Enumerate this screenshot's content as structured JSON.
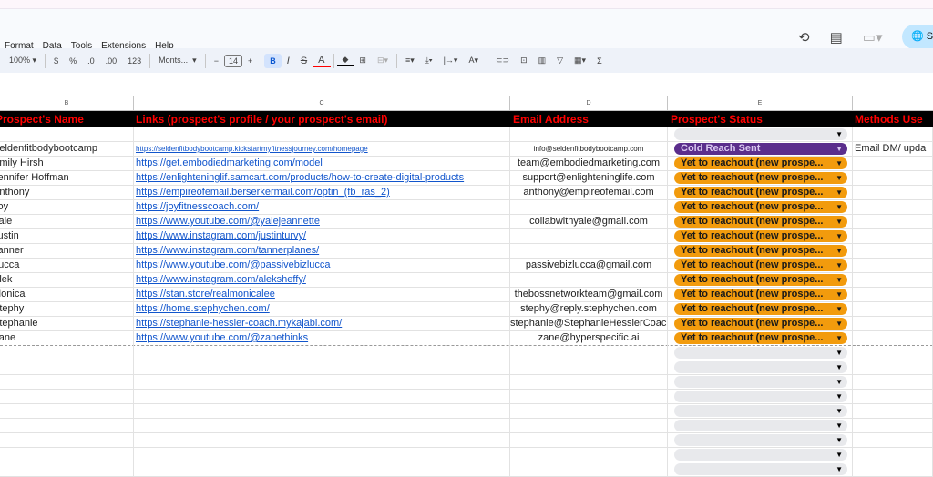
{
  "menu": [
    "Format",
    "Data",
    "Tools",
    "Extensions",
    "Help"
  ],
  "toolbar": {
    "zoom": "100%",
    "currency": "$",
    "percent": "%",
    "dec_decrease": ".0",
    "dec_increase": ".00",
    "number_format": "123",
    "font": "Monts...",
    "font_size": "14",
    "bold": "B",
    "italic": "I",
    "strike": "S",
    "text_color": "A",
    "sum": "Σ"
  },
  "share_label": "S",
  "columns": [
    "B",
    "C",
    "D",
    "E"
  ],
  "headers": {
    "name": "Prospect's Name",
    "links": "Links (prospect's profile / your prospect's email)",
    "email": "Email Address",
    "status": "Prospect's Status",
    "methods": "Methods Use"
  },
  "colors": {
    "orange": "#f29b0d",
    "purple": "#5b2e8c",
    "header_text": "#ff0000"
  },
  "rows": [
    {
      "name": "Seldenfitbodybootcamp",
      "link": "https://seldenfitbodybootcamp.kickstartmyfitnessjourney.com/homepage",
      "email": "info@seldenfitbodybootcamp.com",
      "status": "Cold Reach Sent",
      "status_type": "purple",
      "methods": "Email DM/ upda"
    },
    {
      "name": "Emily Hirsh",
      "link": "https://get.embodiedmarketing.com/model",
      "email": "team@embodiedmarketing.com",
      "status": "Yet to reachout (new prospe...",
      "status_type": "orange",
      "methods": ""
    },
    {
      "name": "Jennifer Hoffman",
      "link": "https://enlighteninglif.samcart.com/products/how-to-create-digital-products",
      "email": "support@enlighteninglife.com",
      "status": "Yet to reachout (new prospe...",
      "status_type": "orange",
      "methods": ""
    },
    {
      "name": "Anthony",
      "link": "https://empireofemail.berserkermail.com/optin_(fb_ras_2)",
      "email": "anthony@empireofemail.com",
      "status": "Yet to reachout (new prospe...",
      "status_type": "orange",
      "methods": ""
    },
    {
      "name": "Joy",
      "link": "https://joyfitnesscoach.com/",
      "email": "",
      "status": "Yet to reachout (new prospe...",
      "status_type": "orange",
      "methods": ""
    },
    {
      "name": "Yale",
      "link": "https://www.youtube.com/@yalejeannette",
      "email": "collabwithyale@gmail.com",
      "status": "Yet to reachout (new prospe...",
      "status_type": "orange",
      "methods": ""
    },
    {
      "name": "Justin",
      "link": "https://www.instagram.com/justinturvy/",
      "email": "",
      "status": "Yet to reachout (new prospe...",
      "status_type": "orange",
      "methods": ""
    },
    {
      "name": "Tanner",
      "link": "https://www.instagram.com/tannerplanes/",
      "email": "",
      "status": "Yet to reachout (new prospe...",
      "status_type": "orange",
      "methods": ""
    },
    {
      "name": "Lucca",
      "link": "https://www.youtube.com/@passivebizlucca",
      "email": "passivebizlucca@gmail.com",
      "status": "Yet to reachout (new prospe...",
      "status_type": "orange",
      "methods": ""
    },
    {
      "name": "Alek",
      "link": "https://www.instagram.com/aleksheffy/",
      "email": "",
      "status": "Yet to reachout (new prospe...",
      "status_type": "orange",
      "methods": ""
    },
    {
      "name": "Monica",
      "link": "https://stan.store/realmonicalee",
      "email": "thebossnetworkteam@gmail.com",
      "status": "Yet to reachout (new prospe...",
      "status_type": "orange",
      "methods": ""
    },
    {
      "name": "Stephy",
      "link": "https://home.stephychen.com/",
      "email": "stephy@reply.stephychen.com",
      "status": "Yet to reachout (new prospe...",
      "status_type": "orange",
      "methods": ""
    },
    {
      "name": "Stephanie",
      "link": "https://stephanie-hessler-coach.mykajabi.com/",
      "email": "stephanie@StephanieHesslerCoach.com",
      "status": "Yet to reachout (new prospe...",
      "status_type": "orange",
      "methods": ""
    },
    {
      "name": "Zane",
      "link": "https://www.youtube.com/@zanethinks",
      "email": "zane@hyperspecific.ai",
      "status": "Yet to reachout (new prospe...",
      "status_type": "orange",
      "methods": ""
    }
  ]
}
